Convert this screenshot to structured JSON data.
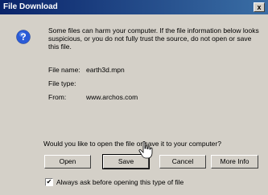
{
  "window": {
    "title": "File Download",
    "close_glyph": "x"
  },
  "message": {
    "text": "Some files can harm your computer. If the file information below looks suspicious, or you do not fully trust the source, do not open or save this file."
  },
  "file_info": {
    "name_label": "File name:",
    "name_value": "earth3d.mpn",
    "type_label": "File type:",
    "type_value": "",
    "from_label": "From:",
    "from_value": "www.archos.com"
  },
  "prompt": {
    "text": "Would you like to open the file or save it to your computer?"
  },
  "buttons": {
    "open_label": "Open",
    "save_label": "Save",
    "cancel_label": "Cancel",
    "more_info_label": "More Info"
  },
  "checkbox": {
    "checked": true,
    "mark": "✔",
    "label": "Always ask before opening this type of file"
  },
  "icons": {
    "question": "question-icon",
    "cursor": "mouse-cursor-icon"
  },
  "colors": {
    "titlebar_start": "#0a246a",
    "titlebar_end": "#3a6ea5",
    "dialog_bg": "#d4d0c8"
  }
}
